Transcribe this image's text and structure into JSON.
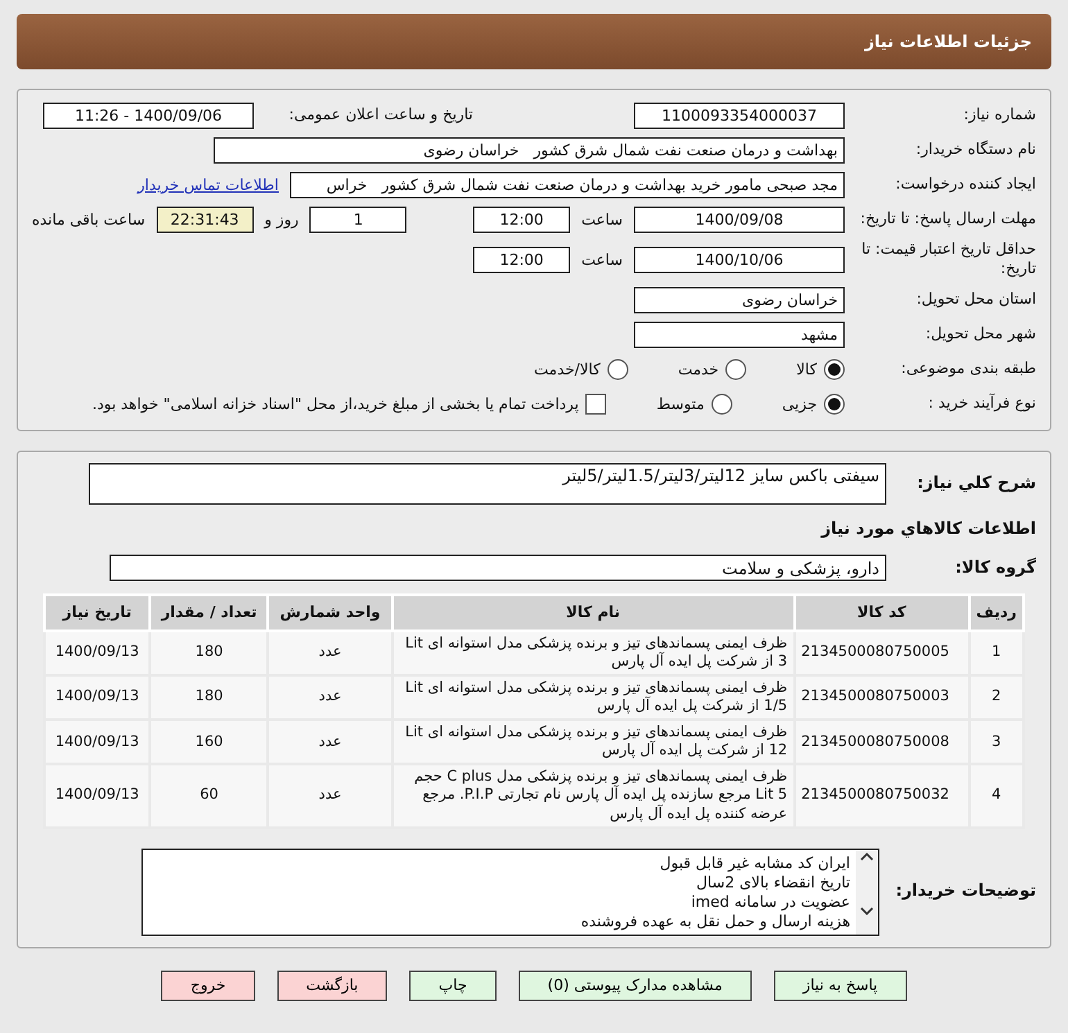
{
  "header": {
    "title": "جزئیات اطلاعات نیاز"
  },
  "need_number": {
    "label": "شماره نیاز:",
    "value": "1100093354000037"
  },
  "announce": {
    "label": "تاریخ و ساعت اعلان عمومی:",
    "value": "1400/09/06 - 11:26"
  },
  "buyer": {
    "label": "نام دستگاه خریدار:",
    "value": "بهداشت و درمان صنعت نفت شمال شرق کشور   خراسان رضوی"
  },
  "creator": {
    "label": "ایجاد کننده درخواست:",
    "value": "مجد صبحی مامور خرید بهداشت و درمان صنعت نفت شمال شرق کشور   خراس",
    "link": "اطلاعات تماس خریدار"
  },
  "deadline": {
    "label": "مهلت ارسال پاسخ: تا تاریخ:",
    "date": "1400/09/08",
    "time_label": "ساعت",
    "time": "12:00",
    "days": "1",
    "days_label": "روز و",
    "remaining": "22:31:43",
    "remaining_label": "ساعت باقی مانده"
  },
  "validity": {
    "label": "حداقل تاریخ اعتبار قیمت: تا تاریخ:",
    "date": "1400/10/06",
    "time_label": "ساعت",
    "time": "12:00"
  },
  "province": {
    "label": "استان محل تحویل:",
    "value": "خراسان رضوی"
  },
  "city": {
    "label": "شهر محل تحویل:",
    "value": "مشهد"
  },
  "category": {
    "label": "طبقه بندی موضوعی:",
    "options": [
      {
        "label": "کالا",
        "selected": true
      },
      {
        "label": "خدمت",
        "selected": false
      },
      {
        "label": "کالا/خدمت",
        "selected": false
      }
    ]
  },
  "process": {
    "label": "نوع فرآیند خرید :",
    "options": [
      {
        "label": "جزیی",
        "selected": true
      },
      {
        "label": "متوسط",
        "selected": false
      }
    ],
    "payment": {
      "label": "پرداخت تمام یا بخشی از مبلغ خرید،از محل \"اسناد خزانه اسلامی\" خواهد بود.",
      "checked": false
    }
  },
  "description": {
    "label": "شرح کلي نياز:",
    "value": "سیفتی باکس سایز 12لیتر/3لیتر/1.5لیتر/5لیتر"
  },
  "goods_title": "اطلاعات کالاهاي مورد نياز",
  "goods_group": {
    "label": "گروه کالا:",
    "value": "دارو، پزشکی و سلامت"
  },
  "table": {
    "columns": [
      "ردیف",
      "کد کالا",
      "نام کالا",
      "واحد شمارش",
      "تعداد / مقدار",
      "تاریخ نیاز"
    ],
    "rows": [
      [
        "1",
        "2134500080750005",
        "ظرف ایمنی پسماندهای تیز و برنده پزشکی مدل استوانه ای Lit 3 از شرکت پل ایده آل پارس",
        "عدد",
        "180",
        "1400/09/13"
      ],
      [
        "2",
        "2134500080750003",
        "ظرف ایمنی پسماندهای تیز و برنده پزشکی مدل استوانه ای Lit 1/5 از شرکت پل ایده آل پارس",
        "عدد",
        "180",
        "1400/09/13"
      ],
      [
        "3",
        "2134500080750008",
        "ظرف ایمنی پسماندهای تیز و برنده پزشکی مدل استوانه ای Lit 12 از شرکت پل ایده آل پارس",
        "عدد",
        "160",
        "1400/09/13"
      ],
      [
        "4",
        "2134500080750032",
        "ظرف ایمنی پسماندهای تیز و برنده پزشکی مدل C plus حجم Lit 5 مرجع سازنده پل ایده آل پارس نام تجارتی P.I.P. مرجع عرضه کننده پل ایده آل پارس",
        "عدد",
        "60",
        "1400/09/13"
      ]
    ]
  },
  "buyer_notes": {
    "label": "توضیحات خریدار:",
    "lines": [
      "ایران کد مشابه غیر قابل قبول",
      "تاریخ انقضاء بالای 2سال",
      "عضویت در سامانه imed",
      "هزینه ارسال و حمل نقل به عهده فروشنده"
    ]
  },
  "buttons": [
    {
      "label": "پاسخ به نیاز",
      "kind": "action"
    },
    {
      "label": "مشاهده مدارک پیوستی (0)",
      "kind": "action"
    },
    {
      "label": "چاپ",
      "kind": "action"
    },
    {
      "label": "بازگشت",
      "kind": "nav"
    },
    {
      "label": "خروج",
      "kind": "nav"
    }
  ]
}
